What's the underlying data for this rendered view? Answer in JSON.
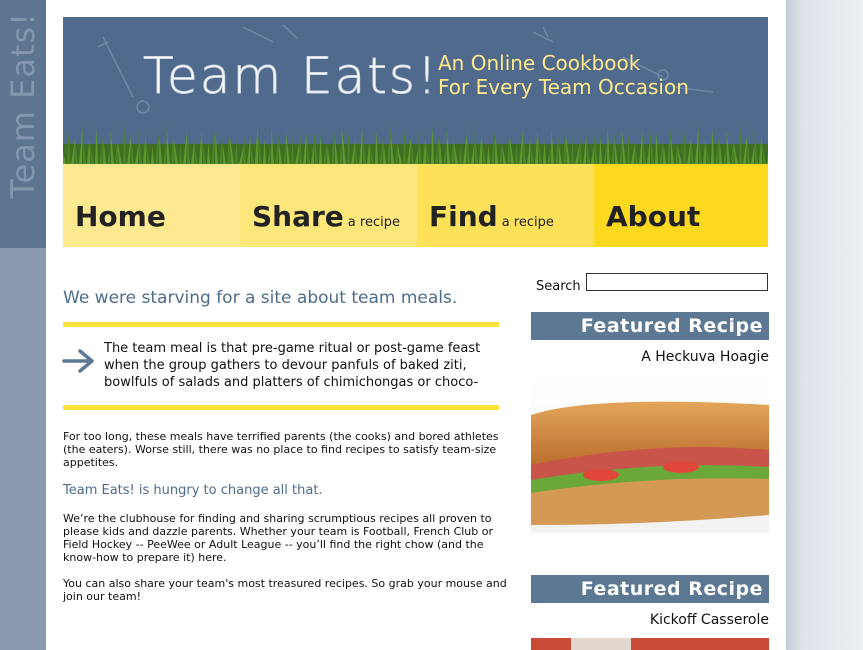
{
  "side_tab": {
    "text": "Team Eats!"
  },
  "banner": {
    "logo": "Team Eats!",
    "tagline_line1": "An Online Cookbook",
    "tagline_line2": "For Every Team Occasion"
  },
  "nav": [
    {
      "label": "Home",
      "sub": "",
      "color": "#fde98f"
    },
    {
      "label": "Share",
      "sub": "a recipe",
      "color": "#fde67a"
    },
    {
      "label": "Find",
      "sub": "a recipe",
      "color": "#fde259"
    },
    {
      "label": "About",
      "sub": "",
      "color": "#fcd91f"
    }
  ],
  "main": {
    "headline": "We were starving for a site about team meals.",
    "intro": "The team meal is that pre-game ritual or post-game feast when the group gathers to devour panfuls of baked ziti, bowlfuls of salads and platters of chimichongas or choco-",
    "para1": "For too long, these meals have terrified parents (the cooks) and bored athletes (the eaters). Worse still, there was no place to find recipes to satisfy team-size appetites.",
    "hungry": "Team Eats! is hungry to change all that.",
    "para2": "We’re the clubhouse for finding and sharing scrumptious recipes all proven to please kids and dazzle parents. Whether your team is Football, French Club or Field Hockey -- PeeWee or Adult League -- you’ll find the right chow (and the know-how to prepare it) here.",
    "para3": "You can also share your team's most treasured recipes. So grab your mouse and join our team!"
  },
  "sidebar": {
    "search_label": "Search",
    "search_value": "",
    "featured": [
      {
        "header": "Featured Recipe",
        "name": "A Heckuva Hoagie"
      },
      {
        "header": "Featured Recipe",
        "name": "Kickoff Casserole"
      }
    ]
  },
  "colors": {
    "banner_bg": "#4f6a8d",
    "accent_yellow": "#fde23b",
    "header_blue": "#5d7893",
    "link_blue": "#4e6c8c"
  }
}
